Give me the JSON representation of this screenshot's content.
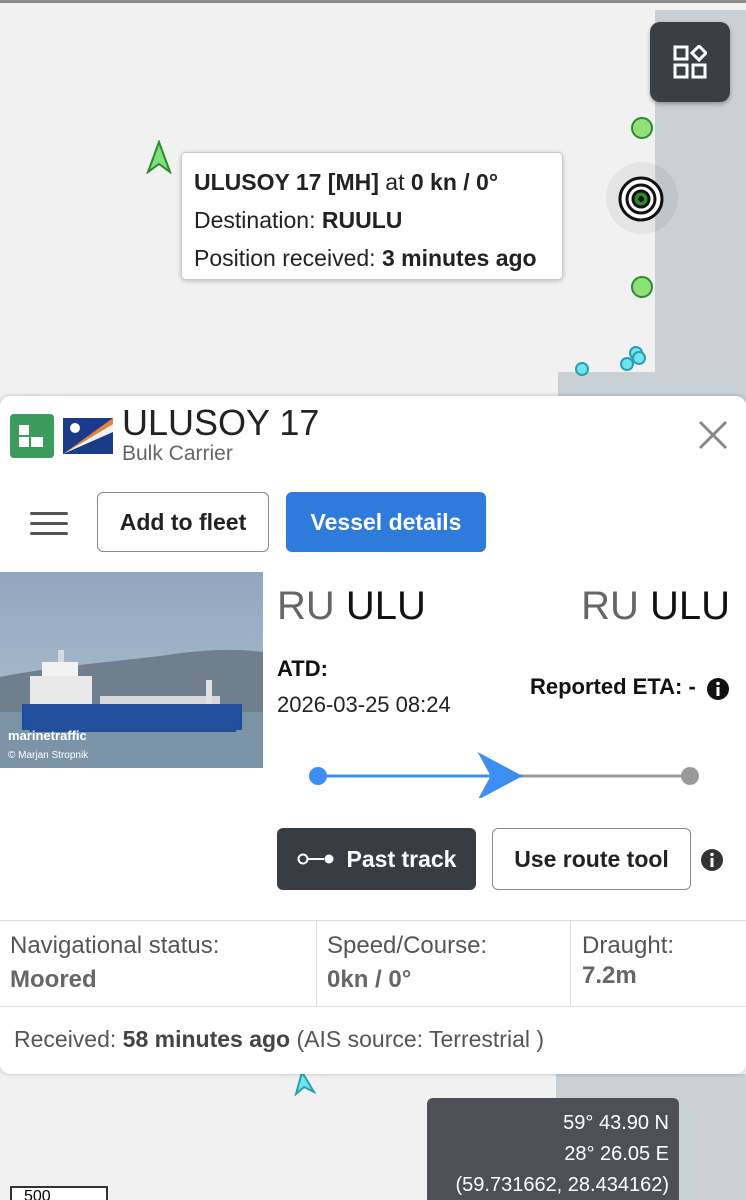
{
  "tooltip": {
    "vessel": "ULUSOY 17 [MH]",
    "at_word": "at",
    "speed_course": "0 kn / 0°",
    "destination_label": "Destination:",
    "destination_value": "RUULU",
    "position_label": "Position received:",
    "position_value": "3 minutes ago"
  },
  "vessel": {
    "name": "ULUSOY 17",
    "type": "Bulk Carrier",
    "photo_watermark": "marinetraffic",
    "photo_credit": "© Marjan Stropnik"
  },
  "actions": {
    "add_to_fleet": "Add to fleet",
    "vessel_details": "Vessel details",
    "past_track": "Past track",
    "use_route_tool": "Use route tool"
  },
  "voyage": {
    "from_country": "RU",
    "from_port": "ULU",
    "to_country": "RU",
    "to_port": "ULU",
    "atd_label": "ATD:",
    "atd_value": "2026-03-25 08:24",
    "eta_label": "Reported ETA: -",
    "progress": 0.55
  },
  "stats": {
    "nav_status_label": "Navigational status:",
    "nav_status_value": "Moored",
    "speed_course_label": "Speed/Course:",
    "speed_course_value": "0kn / 0°",
    "draught_label": "Draught:",
    "draught_value": "7.2m"
  },
  "received": {
    "label": "Received:",
    "value": "58 minutes ago",
    "source": "(AIS source: Terrestrial )"
  },
  "map": {
    "lat": "59° 43.90 N",
    "lon": "28° 26.05 E",
    "decimal": "(59.731662, 28.434162)",
    "scale": "500"
  },
  "colors": {
    "accent": "#2f7bdc",
    "vessel_green": "#3a9b5d",
    "track_blue": "#3d8ef0"
  }
}
